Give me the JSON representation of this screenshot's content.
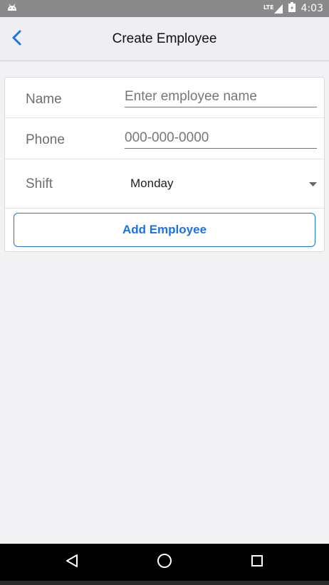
{
  "status_bar": {
    "time": "4:03",
    "network": "LTE",
    "icons": [
      "android-icon",
      "signal-icon",
      "battery-icon"
    ]
  },
  "nav": {
    "title": "Create Employee",
    "back_icon": "chevron-left-icon",
    "accent_color": "#1a73e8"
  },
  "form": {
    "name": {
      "label": "Name",
      "value": "",
      "placeholder": "Enter employee name"
    },
    "phone": {
      "label": "Phone",
      "value": "",
      "placeholder": "000-000-0000"
    },
    "shift": {
      "label": "Shift",
      "value": "Monday",
      "icon": "dropdown-arrow-icon"
    },
    "submit_label": "Add Employee"
  },
  "system_nav": {
    "buttons": [
      "back-triangle-icon",
      "home-circle-icon",
      "recents-square-icon"
    ]
  }
}
